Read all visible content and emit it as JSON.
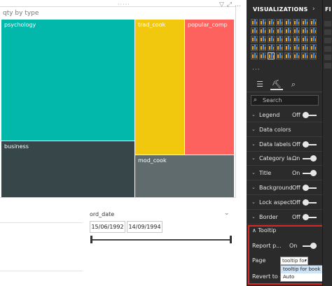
{
  "canvas": {
    "chart_title": "qty by type",
    "treemap": [
      {
        "label": "psychology",
        "color": "#01b8aa"
      },
      {
        "label": "trad_cook",
        "color": "#f2c80f"
      },
      {
        "label": "popular_comp",
        "color": "#fd625e"
      },
      {
        "label": "business",
        "color": "#374649"
      },
      {
        "label": "mod_cook",
        "color": "#5f6b6d"
      }
    ],
    "slicer": {
      "title": "ord_date",
      "start_date": "15/06/1992",
      "end_date": "14/09/1994"
    }
  },
  "viz_pane": {
    "title": "VISUALIZATIONS",
    "search_placeholder": "Search",
    "format_cards": [
      {
        "label": "Legend",
        "state": "Off"
      },
      {
        "label": "Data colors",
        "state": ""
      },
      {
        "label": "Data labels",
        "state": "Off"
      },
      {
        "label": "Category la...",
        "state": "On"
      },
      {
        "label": "Title",
        "state": "On"
      },
      {
        "label": "Background",
        "state": "Off"
      },
      {
        "label": "Lock aspect",
        "state": "Off"
      },
      {
        "label": "Border",
        "state": "Off"
      }
    ],
    "tooltip": {
      "header": "Tooltip",
      "report_page_label": "Report p...",
      "report_page_state": "On",
      "page_label": "Page",
      "page_value": "tooltip for ...",
      "revert_label": "Revert to def",
      "dropdown_options": [
        "tooltip for book types",
        "Auto"
      ]
    }
  },
  "fields_pane": {
    "title": "FI"
  }
}
